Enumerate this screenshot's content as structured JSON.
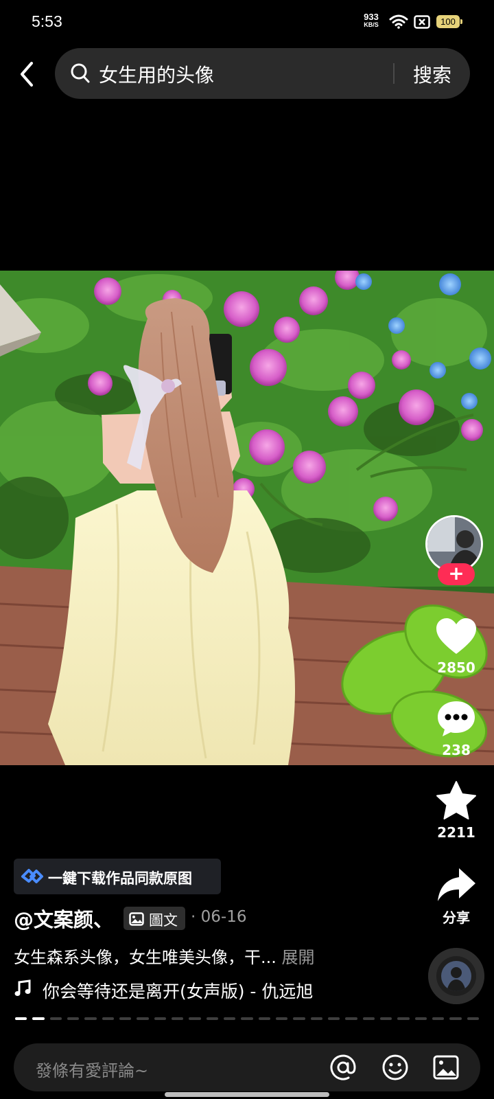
{
  "status_bar": {
    "time": "5:53",
    "net_speed_value": "933",
    "net_speed_unit": "KB/S",
    "battery": "100"
  },
  "search": {
    "query": "女生用的头像",
    "button_label": "搜索"
  },
  "side_actions": {
    "likes": "2850",
    "comments": "238",
    "favorites": "2211",
    "share_label": "分享"
  },
  "post": {
    "download_banner": "一鍵下载作品同款原图",
    "author": "@文案颜、",
    "type_tag": "圖文",
    "date": "· 06-16",
    "caption": "女生森系头像，女生唯美头像，干...",
    "caption_more": "展開",
    "music": "你会等待还是离开(女声版) - 仇远旭",
    "slide_count": 27,
    "current_slide": 2
  },
  "comment_bar": {
    "placeholder": "發條有愛評論~"
  },
  "colors": {
    "accent": "#fe2c55",
    "background": "#000000",
    "search_bg": "#2b2b2b"
  }
}
